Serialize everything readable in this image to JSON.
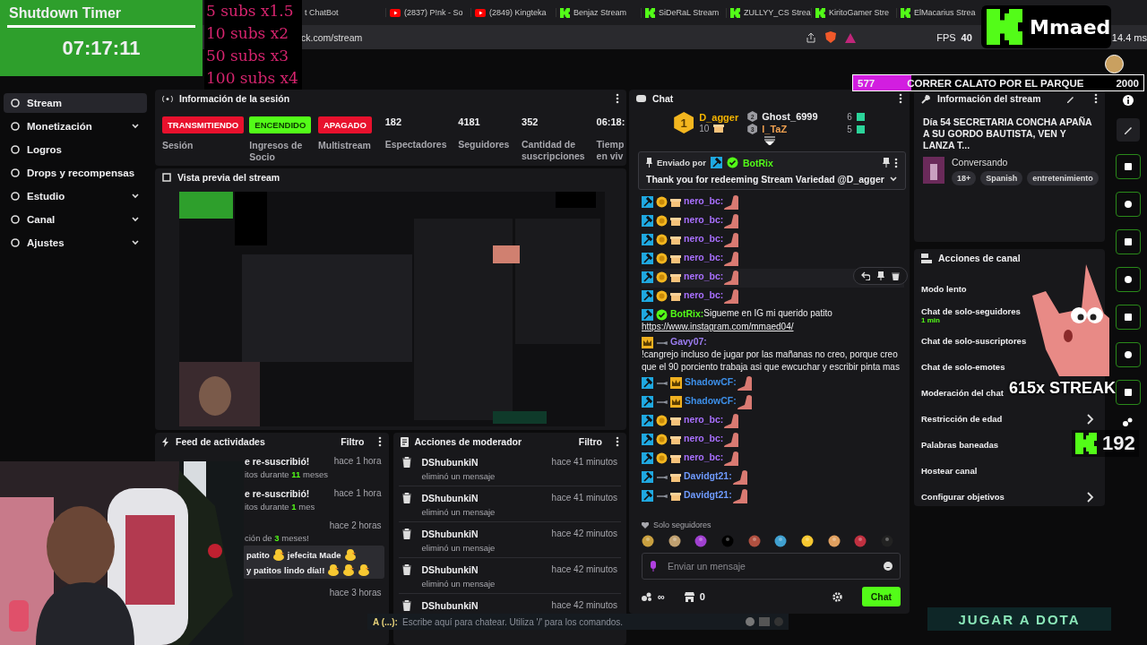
{
  "browser": {
    "tabs": [
      {
        "label": "t ChatBot",
        "kind": "none"
      },
      {
        "label": "(2837) P!nk - So",
        "kind": "youtube"
      },
      {
        "label": "(2849) Kingteka",
        "kind": "youtube"
      },
      {
        "label": "Benjaz Stream",
        "kind": "kick"
      },
      {
        "label": "SiDeRaL Stream",
        "kind": "kick"
      },
      {
        "label": "ZULLYY_CS Strea",
        "kind": "kick"
      },
      {
        "label": "KiritoGamer Stre",
        "kind": "kick"
      },
      {
        "label": "ElMacarius Strea",
        "kind": "kick"
      }
    ],
    "address": "ck.com/stream",
    "fps_label": "FPS",
    "fps": "40",
    "frame_time": "14.4 ms"
  },
  "sidebar": {
    "items": [
      {
        "label": "Stream",
        "selected": true,
        "expandable": false
      },
      {
        "label": "Monetización",
        "selected": false,
        "expandable": true
      },
      {
        "label": "Logros",
        "selected": false,
        "expandable": false
      },
      {
        "label": "Drops y recompensas",
        "selected": false,
        "expandable": false
      },
      {
        "label": "Estudio",
        "selected": false,
        "expandable": true
      },
      {
        "label": "Canal",
        "selected": false,
        "expandable": true
      },
      {
        "label": "Ajustes",
        "selected": false,
        "expandable": true
      }
    ]
  },
  "session": {
    "title": "Información de la sesión",
    "stats": [
      {
        "kind": "tag",
        "value": "TRANSMITIENDO",
        "color": "#e8112d",
        "label": "Sesión"
      },
      {
        "kind": "tag",
        "value": "ENCENDIDO",
        "color": "#53fc18",
        "label": "Ingresos de Socio"
      },
      {
        "kind": "tag",
        "value": "APAGADO",
        "color": "#e8112d",
        "label": "Multistream"
      },
      {
        "kind": "number",
        "value": "182",
        "label": "Espectadores"
      },
      {
        "kind": "number",
        "value": "4181",
        "label": "Seguidores"
      },
      {
        "kind": "number",
        "value": "352",
        "label": "Cantidad de suscripciones"
      },
      {
        "kind": "number",
        "value": "06:18:",
        "label": "Tiemp en viv"
      }
    ]
  },
  "preview": {
    "title": "Vista previa del stream"
  },
  "feed": {
    "title": "Feed de actividades",
    "filter": "Filtro",
    "items": [
      {
        "main": "e re-suscribió!",
        "sub": "itos durante **11** meses",
        "time": "hace 1 hora"
      },
      {
        "main": "e re-suscribió!",
        "sub": "itos durante **1** mes",
        "time": "hace 1 hora"
      },
      {
        "sub": "ción de **3** meses!",
        "time": "hace 2 horas",
        "message": [
          {
            "kind": "text",
            "text": "patito"
          },
          {
            "kind": "emote"
          },
          {
            "kind": "text",
            "text": "jefecita Made"
          },
          {
            "kind": "emote"
          },
          {
            "kind": "text",
            "text": "y patitos"
          },
          {
            "kind": "text",
            "text": "lindo día!!"
          },
          {
            "kind": "emote"
          },
          {
            "kind": "emote"
          },
          {
            "kind": "emote"
          }
        ]
      },
      {
        "time": "hace 3 horas"
      }
    ]
  },
  "moderation": {
    "title": "Acciones de moderador",
    "filter": "Filtro",
    "items": [
      {
        "user": "DShubunkiN",
        "action": "eliminó un mensaje",
        "time": "hace 41 minutos"
      },
      {
        "user": "DShubunkiN",
        "action": "eliminó un mensaje",
        "time": "hace 41 minutos"
      },
      {
        "user": "DShubunkiN",
        "action": "eliminó un mensaje",
        "time": "hace 42 minutos"
      },
      {
        "user": "DShubunkiN",
        "action": "eliminó un mensaje",
        "time": "hace 42 minutos"
      },
      {
        "user": "DShubunkiN",
        "time": "hace 42 minutos"
      }
    ]
  },
  "chat": {
    "title": "Chat",
    "leaders": [
      {
        "rank": "1",
        "name": "D_agger",
        "count": "10",
        "color": "#f5b400"
      },
      {
        "rank": "2",
        "name": "Ghost_6999",
        "count": "6",
        "color": "#efeff1"
      },
      {
        "rank": "3",
        "name": "l_TaZ",
        "count": "5",
        "color": "#f0a050"
      }
    ],
    "pinned": {
      "label": "Enviado por",
      "user": "BotRix",
      "text": "Thank you for redeeming Stream Variedad @D_agger"
    },
    "messages": [
      {
        "user": "nero_bc:",
        "color": "#a970ff",
        "badges": [
          {
            "kind": "mod"
          },
          {
            "kind": "sub"
          },
          {
            "kind": "gift"
          }
        ],
        "kind": "emote",
        "hovered": false
      },
      {
        "user": "nero_bc:",
        "color": "#a970ff",
        "badges": [
          {
            "kind": "mod"
          },
          {
            "kind": "sub"
          },
          {
            "kind": "gift"
          }
        ],
        "kind": "emote",
        "hovered": false
      },
      {
        "user": "nero_bc:",
        "color": "#a970ff",
        "badges": [
          {
            "kind": "mod"
          },
          {
            "kind": "sub"
          },
          {
            "kind": "gift"
          }
        ],
        "kind": "emote",
        "hovered": false
      },
      {
        "user": "nero_bc:",
        "color": "#a970ff",
        "badges": [
          {
            "kind": "mod"
          },
          {
            "kind": "sub"
          },
          {
            "kind": "gift"
          }
        ],
        "kind": "emote",
        "hovered": false
      },
      {
        "user": "nero_bc:",
        "color": "#a970ff",
        "badges": [
          {
            "kind": "mod"
          },
          {
            "kind": "sub"
          },
          {
            "kind": "gift"
          }
        ],
        "kind": "emote",
        "hovered": true
      },
      {
        "user": "nero_bc:",
        "color": "#a970ff",
        "badges": [
          {
            "kind": "mod"
          },
          {
            "kind": "sub"
          },
          {
            "kind": "gift"
          }
        ],
        "kind": "emote",
        "hovered": false
      },
      {
        "user": "BotRix:",
        "color": "#53fc18",
        "badges": [
          {
            "kind": "mod"
          },
          {
            "kind": "verified"
          }
        ],
        "kind": "text",
        "text": "Sigueme en IG mi querido patito",
        "link": "https://www.instagram.com/mmaed04/",
        "hovered": false
      },
      {
        "user": "Gavy07:",
        "color": "#9b7cf0",
        "badges": [
          {
            "kind": "crown"
          },
          {
            "kind": "sword"
          }
        ],
        "kind": "text",
        "text": "!cangrejo incluso de jugar por las mañanas no creo, porque creo que el 90 porciento trabaja asi que ewcuchar y escribir pinta mas",
        "hovered": false
      },
      {
        "user": "ShadowCF:",
        "color": "#3d8fe8",
        "badges": [
          {
            "kind": "mod"
          },
          {
            "kind": "sword"
          },
          {
            "kind": "crown"
          }
        ],
        "kind": "emote",
        "hovered": false
      },
      {
        "user": "ShadowCF:",
        "color": "#3d8fe8",
        "badges": [
          {
            "kind": "mod"
          },
          {
            "kind": "sword"
          },
          {
            "kind": "crown"
          }
        ],
        "kind": "emote",
        "hovered": false
      },
      {
        "user": "nero_bc:",
        "color": "#a970ff",
        "badges": [
          {
            "kind": "mod"
          },
          {
            "kind": "sub"
          },
          {
            "kind": "gift"
          }
        ],
        "kind": "emote",
        "hovered": false
      },
      {
        "user": "nero_bc:",
        "color": "#a970ff",
        "badges": [
          {
            "kind": "mod"
          },
          {
            "kind": "sub"
          },
          {
            "kind": "gift"
          }
        ],
        "kind": "emote",
        "hovered": false
      },
      {
        "user": "nero_bc:",
        "color": "#a970ff",
        "badges": [
          {
            "kind": "mod"
          },
          {
            "kind": "sub"
          },
          {
            "kind": "gift"
          }
        ],
        "kind": "emote",
        "hovered": false
      },
      {
        "user": "Davidgt21:",
        "color": "#6f9bff",
        "badges": [
          {
            "kind": "mod"
          },
          {
            "kind": "sword"
          },
          {
            "kind": "gift"
          }
        ],
        "kind": "emote",
        "hovered": false
      },
      {
        "user": "Davidgt21:",
        "color": "#6f9bff",
        "badges": [
          {
            "kind": "mod"
          },
          {
            "kind": "sword"
          },
          {
            "kind": "gift"
          }
        ],
        "kind": "emote",
        "hovered": false
      }
    ],
    "mode": "Solo seguidores",
    "placeholder": "Enviar un mensaje",
    "points": "∞",
    "store": "0",
    "send": "Chat"
  },
  "stream_info": {
    "title": "Información del stream",
    "stream_title": "Día 54 SECRETARIA CONCHA APAÑA A SU GORDO BAUTISTA, VEN Y LANZA T...",
    "category": "Conversando",
    "tags": [
      "18+",
      "Spanish",
      "entretenimiento"
    ]
  },
  "channel_actions": {
    "title": "Acciones de canal",
    "items": [
      {
        "label": "Modo lento"
      },
      {
        "label": "Chat de solo-seguidores",
        "detail": "1 min"
      },
      {
        "label": "Chat de solo-suscriptores"
      },
      {
        "label": "Chat de solo-emotes"
      },
      {
        "label": "Moderación del chat"
      },
      {
        "label": "Restricción de edad",
        "submenu": true
      },
      {
        "label": "Palabras baneadas"
      },
      {
        "label": "Hostear canal",
        "submenu": false
      },
      {
        "label": "Configurar objetivos",
        "submenu": true
      }
    ]
  },
  "overlays": {
    "timer": {
      "title": "Shutdown Timer",
      "time": "07:17:11"
    },
    "multipliers": [
      "5 subs x1.5",
      "10 subs x2",
      "50 subs x3",
      "100 subs x4"
    ],
    "brand": "Mmaed",
    "goal": {
      "current": "577",
      "title": "CORRER CALATO POR EL PARQUE",
      "target": "2000",
      "level": 0.2
    },
    "streak": "615x STREAK",
    "viewers": "192",
    "game_banner": "JUGAR A DOTA",
    "game_chat": {
      "prefix": "A (...):",
      "placeholder": "Escribe aquí para chatear. Utiliza '/' para los comandos."
    }
  }
}
